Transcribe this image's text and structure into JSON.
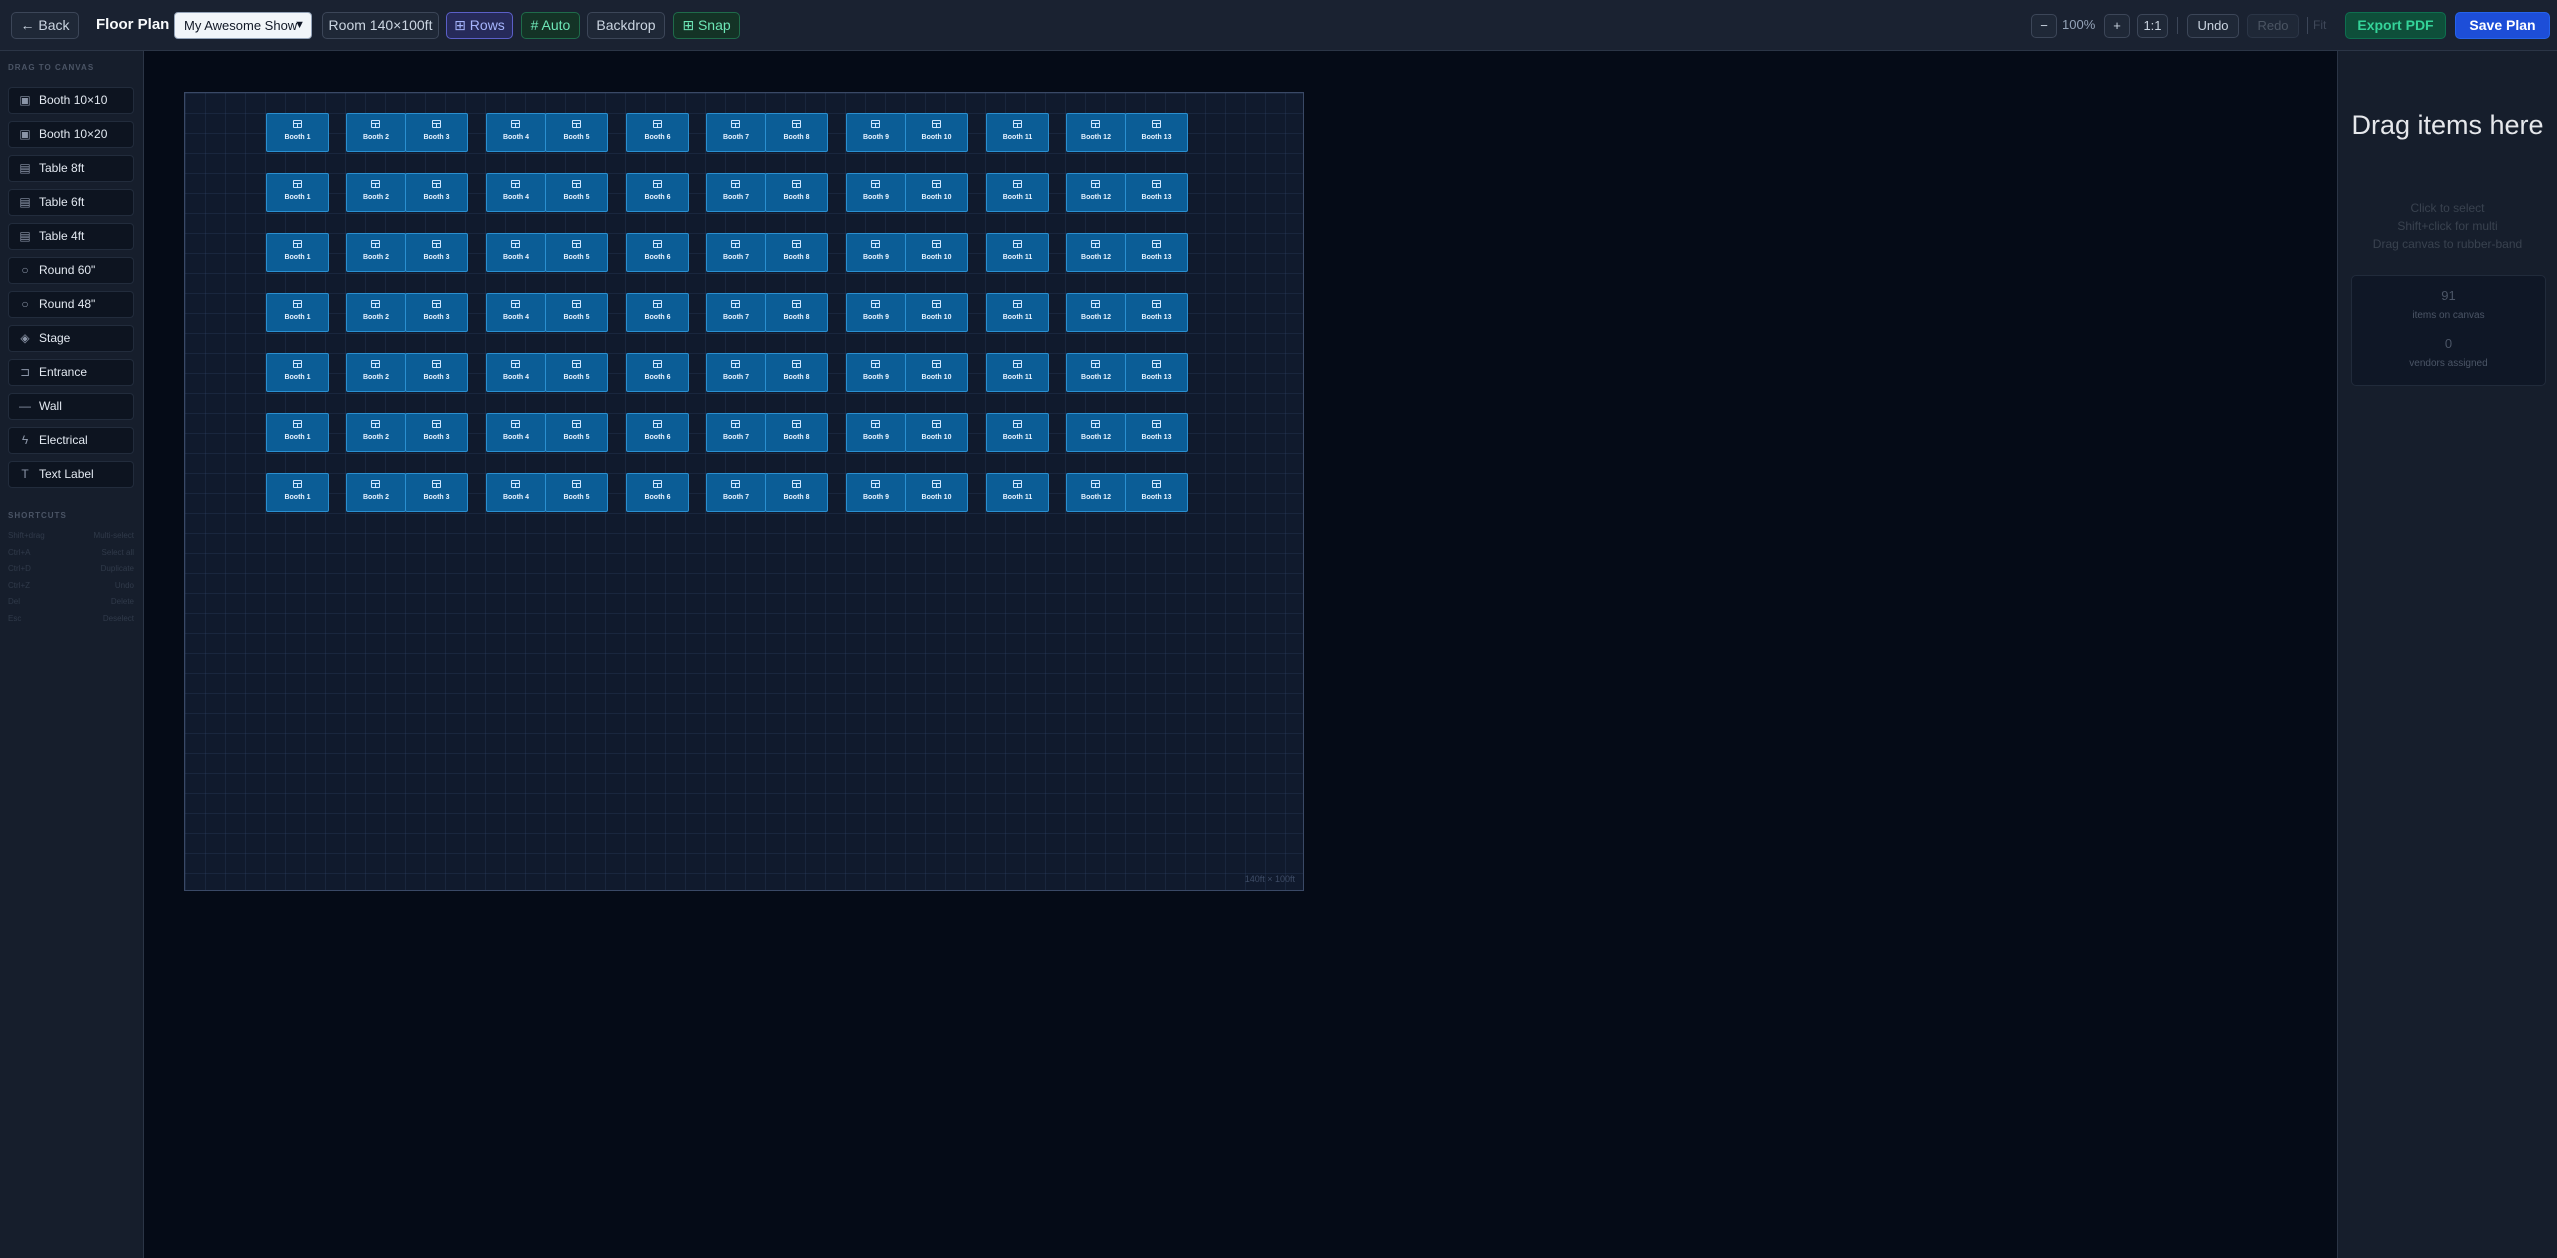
{
  "header": {
    "back_label": "← Back",
    "title": "Floor Plan",
    "show_select": "My Awesome Show",
    "room_label": "Room 140×100ft",
    "rows_label": "⊞ Rows",
    "auto_label": "# Auto",
    "backdrop_label": "Backdrop",
    "snap_label": "⊞ Snap",
    "zoom_out": "−",
    "zoom_level": "100%",
    "zoom_in": "+",
    "zoom_reset": "1:1",
    "undo": "Undo",
    "redo": "Redo",
    "fitted_hint": "Fit",
    "export": "Export PDF",
    "save": "Save Plan"
  },
  "sidebar": {
    "heading": "DRAG TO CANVAS",
    "items": [
      {
        "label": "Booth 10×10",
        "icon": "booth-icon"
      },
      {
        "label": "Booth 10×20",
        "icon": "booth-icon"
      },
      {
        "label": "Table 8ft",
        "icon": "table-icon"
      },
      {
        "label": "Table 6ft",
        "icon": "table-icon"
      },
      {
        "label": "Table 4ft",
        "icon": "table-icon"
      },
      {
        "label": "Round 60\"",
        "icon": "circle-icon"
      },
      {
        "label": "Round 48\"",
        "icon": "circle-icon"
      },
      {
        "label": "Stage",
        "icon": "layers-icon"
      },
      {
        "label": "Entrance",
        "icon": "door-icon"
      },
      {
        "label": "Wall",
        "icon": "line-icon"
      },
      {
        "label": "Electrical",
        "icon": "bolt-icon"
      },
      {
        "label": "Text Label",
        "icon": "text-icon"
      }
    ],
    "shortcuts_heading": "SHORTCUTS",
    "shortcuts": [
      {
        "key": "Shift+drag",
        "action": "Multi-select"
      },
      {
        "key": "Ctrl+A",
        "action": "Select all"
      },
      {
        "key": "Ctrl+D",
        "action": "Duplicate"
      },
      {
        "key": "Ctrl+Z",
        "action": "Undo"
      },
      {
        "key": "Del",
        "action": "Delete"
      },
      {
        "key": "Esc",
        "action": "Deselect"
      }
    ]
  },
  "canvas": {
    "room_size": "140ft × 100ft",
    "booth_rows": [
      [
        "Booth 1",
        "Booth 2",
        "Booth 3",
        "Booth 4",
        "Booth 5",
        "Booth 6",
        "Booth 7",
        "Booth 8",
        "Booth 9",
        "Booth 10",
        "Booth 11",
        "Booth 12",
        "Booth 13"
      ],
      [
        "Booth 1",
        "Booth 2",
        "Booth 3",
        "Booth 4",
        "Booth 5",
        "Booth 6",
        "Booth 7",
        "Booth 8",
        "Booth 9",
        "Booth 10",
        "Booth 11",
        "Booth 12",
        "Booth 13"
      ],
      [
        "Booth 1",
        "Booth 2",
        "Booth 3",
        "Booth 4",
        "Booth 5",
        "Booth 6",
        "Booth 7",
        "Booth 8",
        "Booth 9",
        "Booth 10",
        "Booth 11",
        "Booth 12",
        "Booth 13"
      ],
      [
        "Booth 1",
        "Booth 2",
        "Booth 3",
        "Booth 4",
        "Booth 5",
        "Booth 6",
        "Booth 7",
        "Booth 8",
        "Booth 9",
        "Booth 10",
        "Booth 11",
        "Booth 12",
        "Booth 13"
      ],
      [
        "Booth 1",
        "Booth 2",
        "Booth 3",
        "Booth 4",
        "Booth 5",
        "Booth 6",
        "Booth 7",
        "Booth 8",
        "Booth 9",
        "Booth 10",
        "Booth 11",
        "Booth 12",
        "Booth 13"
      ],
      [
        "Booth 1",
        "Booth 2",
        "Booth 3",
        "Booth 4",
        "Booth 5",
        "Booth 6",
        "Booth 7",
        "Booth 8",
        "Booth 9",
        "Booth 10",
        "Booth 11",
        "Booth 12",
        "Booth 13"
      ],
      [
        "Booth 1",
        "Booth 2",
        "Booth 3",
        "Booth 4",
        "Booth 5",
        "Booth 6",
        "Booth 7",
        "Booth 8",
        "Booth 9",
        "Booth 10",
        "Booth 11",
        "Booth 12",
        "Booth 13"
      ]
    ]
  },
  "right_panel": {
    "title": "Drag items here",
    "hints": [
      "Click to select",
      "Shift+click for multi",
      "Drag canvas to rubber-band"
    ],
    "items_count": "91",
    "items_label": "items on canvas",
    "vendors_count": "0",
    "vendors_label": "vendors assigned"
  },
  "colors": {
    "background": "#050b17",
    "booth_fill": "#0b5d96",
    "accent_save": "#1d4ed8",
    "accent_export": "#0e4f3a"
  }
}
